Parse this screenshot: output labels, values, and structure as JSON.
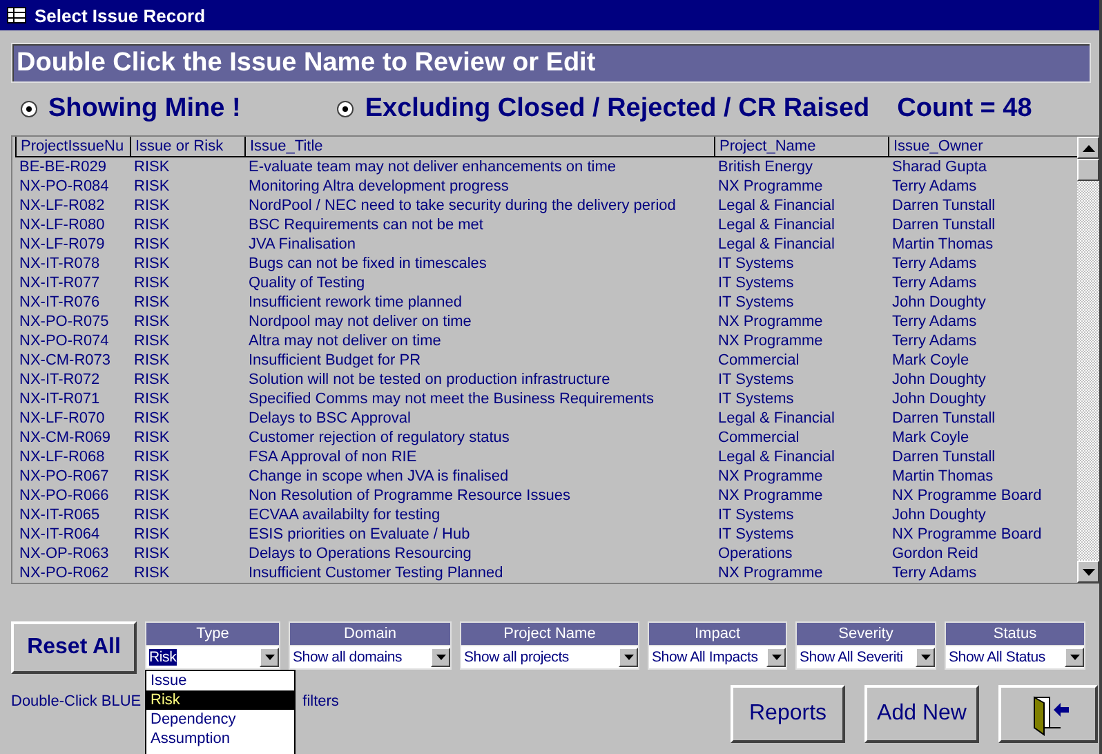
{
  "window": {
    "title": "Select Issue Record"
  },
  "banner": "Double Click the Issue Name to Review or Edit",
  "options": [
    {
      "label": "Showing Mine !",
      "selected": true
    },
    {
      "label": "Excluding Closed / Rejected / CR Raised",
      "selected": true
    }
  ],
  "count": "Count = 48",
  "table": {
    "columns": [
      "ProjectIssueNu",
      "Issue or Risk",
      "Issue_Title",
      "Project_Name",
      "Issue_Owner"
    ],
    "rows": [
      [
        "BE-BE-R029",
        "RISK",
        "E-valuate team may not deliver enhancements on time",
        "British Energy",
        "Sharad Gupta"
      ],
      [
        "NX-PO-R084",
        "RISK",
        "Monitoring Altra development progress",
        "NX Programme",
        "Terry Adams"
      ],
      [
        "NX-LF-R082",
        "RISK",
        "NordPool / NEC need to take security during the delivery period",
        "Legal & Financial",
        "Darren Tunstall"
      ],
      [
        "NX-LF-R080",
        "RISK",
        "BSC Requirements can not be met",
        "Legal & Financial",
        "Darren Tunstall"
      ],
      [
        "NX-LF-R079",
        "RISK",
        "JVA Finalisation",
        "Legal & Financial",
        "Martin Thomas"
      ],
      [
        "NX-IT-R078",
        "RISK",
        "Bugs can not be fixed in timescales",
        "IT Systems",
        "Terry Adams"
      ],
      [
        "NX-IT-R077",
        "RISK",
        "Quality of Testing",
        "IT Systems",
        "Terry Adams"
      ],
      [
        "NX-IT-R076",
        "RISK",
        "Insufficient rework time planned",
        "IT Systems",
        "John Doughty"
      ],
      [
        "NX-PO-R075",
        "RISK",
        "Nordpool may not deliver on time",
        "NX Programme",
        "Terry Adams"
      ],
      [
        "NX-PO-R074",
        "RISK",
        "Altra may not deliver on time",
        "NX Programme",
        "Terry Adams"
      ],
      [
        "NX-CM-R073",
        "RISK",
        "Insufficient Budget for PR",
        "Commercial",
        "Mark Coyle"
      ],
      [
        "NX-IT-R072",
        "RISK",
        "Solution will not be tested on production infrastructure",
        "IT Systems",
        "John Doughty"
      ],
      [
        "NX-IT-R071",
        "RISK",
        "Specified Comms may not meet the Business Requirements",
        "IT Systems",
        "John Doughty"
      ],
      [
        "NX-LF-R070",
        "RISK",
        "Delays to BSC Approval",
        "Legal & Financial",
        "Darren Tunstall"
      ],
      [
        "NX-CM-R069",
        "RISK",
        "Customer rejection of regulatory status",
        "Commercial",
        "Mark Coyle"
      ],
      [
        "NX-LF-R068",
        "RISK",
        "FSA Approval of non RIE",
        "Legal & Financial",
        "Darren Tunstall"
      ],
      [
        "NX-PO-R067",
        "RISK",
        "Change in scope when JVA is finalised",
        "NX Programme",
        "Martin Thomas"
      ],
      [
        "NX-PO-R066",
        "RISK",
        "Non Resolution of Programme Resource Issues",
        "NX Programme",
        "NX Programme Board"
      ],
      [
        "NX-IT-R065",
        "RISK",
        "ECVAA availabilty for testing",
        "IT Systems",
        "John Doughty"
      ],
      [
        "NX-IT-R064",
        "RISK",
        "ESIS priorities on Evaluate / Hub",
        "IT Systems",
        "NX Programme Board"
      ],
      [
        "NX-OP-R063",
        "RISK",
        "Delays to Operations Resourcing",
        "Operations",
        "Gordon Reid"
      ],
      [
        "NX-PO-R062",
        "RISK",
        "Insufficient Customer Testing Planned",
        "NX Programme",
        "Terry Adams"
      ]
    ]
  },
  "reset_button": "Reset All",
  "filters": [
    {
      "label": "Type",
      "value": "Risk",
      "expanded": true
    },
    {
      "label": "Domain",
      "value": "Show all domains",
      "expanded": false
    },
    {
      "label": "Project Name",
      "value": "Show all projects",
      "expanded": false
    },
    {
      "label": "Impact",
      "value": "Show All Impacts",
      "expanded": false
    },
    {
      "label": "Severity",
      "value": "Show All Severiti",
      "expanded": false
    },
    {
      "label": "Status",
      "value": "Show All Status",
      "expanded": false
    }
  ],
  "type_options": [
    {
      "label": "Issue",
      "selected": false
    },
    {
      "label": "Risk",
      "selected": true
    },
    {
      "label": "Dependency",
      "selected": false
    },
    {
      "label": "Assumption",
      "selected": false
    }
  ],
  "hint": [
    "Double-Click BLUE",
    "filters"
  ],
  "buttons": [
    {
      "kind": "text",
      "label": "Reports"
    },
    {
      "kind": "text",
      "label": "Add New"
    },
    {
      "kind": "exit"
    }
  ]
}
